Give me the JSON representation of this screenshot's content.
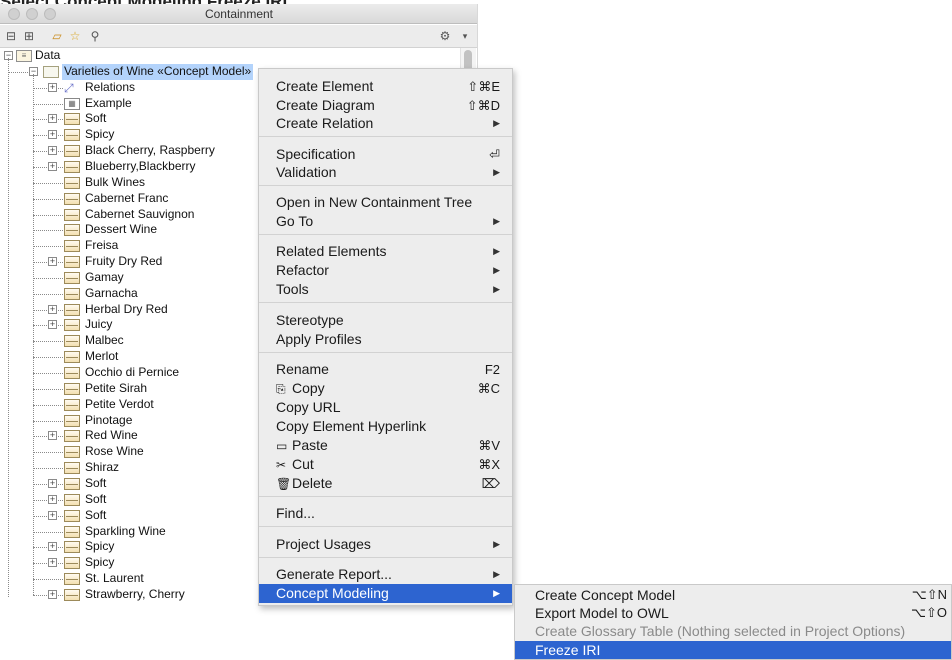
{
  "caption": "Select Concept Modeling Freeze IRI",
  "window": {
    "title": "Containment"
  },
  "toolbar": {
    "icons": [
      "collapse-icon",
      "expand-icon",
      "open-folder-icon",
      "star-icon",
      "search-icon",
      "gear-icon",
      "dropdown-icon"
    ]
  },
  "tree": {
    "root": "Data",
    "model": "Varieties of Wine «Concept Model»",
    "children": [
      "Relations",
      "Example",
      "Soft",
      "Spicy",
      "Black Cherry, Raspberry",
      "Blueberry,Blackberry",
      "Bulk Wines",
      "Cabernet Franc",
      "Cabernet Sauvignon",
      "Dessert Wine",
      "Freisa",
      "Fruity Dry Red",
      "Gamay",
      "Garnacha",
      "Herbal Dry Red",
      "Juicy",
      "Malbec",
      "Merlot",
      "Occhio di Pernice",
      "Petite Sirah",
      "Petite Verdot",
      "Pinotage",
      "Red Wine",
      "Rose Wine",
      "Shiraz",
      "Soft",
      "Soft",
      "Soft",
      "Sparkling Wine",
      "Spicy",
      "Spicy",
      "St. Laurent",
      "Strawberry, Cherry"
    ]
  },
  "menu": {
    "create_element": "Create Element",
    "create_element_sc": "⇧⌘E",
    "create_diagram": "Create Diagram",
    "create_diagram_sc": "⇧⌘D",
    "create_relation": "Create Relation",
    "specification": "Specification",
    "specification_sc": "⏎",
    "validation": "Validation",
    "open_new_tree": "Open in New Containment Tree",
    "go_to": "Go To",
    "related_elements": "Related Elements",
    "refactor": "Refactor",
    "tools": "Tools",
    "stereotype": "Stereotype",
    "apply_profiles": "Apply Profiles",
    "rename": "Rename",
    "rename_sc": "F2",
    "copy": "Copy",
    "copy_sc": "⌘C",
    "copy_url": "Copy URL",
    "copy_hyperlink": "Copy Element Hyperlink",
    "paste": "Paste",
    "paste_sc": "⌘V",
    "cut": "Cut",
    "cut_sc": "⌘X",
    "delete": "Delete",
    "delete_sc": "⌦",
    "find": "Find...",
    "project_usages": "Project Usages",
    "generate_report": "Generate Report...",
    "concept_modeling": "Concept Modeling"
  },
  "submenu": {
    "create_concept_model": "Create Concept Model",
    "create_concept_model_sc": "⌥⇧N",
    "export_owl": "Export Model to OWL",
    "export_owl_sc": "⌥⇧O",
    "create_glossary": "Create Glossary Table (Nothing selected in Project Options)",
    "freeze_iri": "Freeze IRI"
  },
  "colors": {
    "highlight": "#2d64d0",
    "selection": "#b3d3fb"
  }
}
